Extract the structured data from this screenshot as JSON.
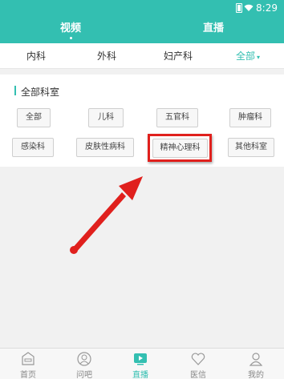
{
  "status_bar": {
    "time": "8:29"
  },
  "top_tabs": [
    {
      "label": "视频"
    },
    {
      "label": "直播"
    }
  ],
  "categories": [
    {
      "label": "内科"
    },
    {
      "label": "外科"
    },
    {
      "label": "妇产科"
    },
    {
      "label": "全部"
    }
  ],
  "panel": {
    "title": "全部科室",
    "departments": [
      {
        "label": "全部"
      },
      {
        "label": "儿科"
      },
      {
        "label": "五官科"
      },
      {
        "label": "肿瘤科"
      },
      {
        "label": "感染科"
      },
      {
        "label": "皮肤性病科"
      },
      {
        "label": "精神心理科"
      },
      {
        "label": "其他科室"
      }
    ]
  },
  "bottom_nav": [
    {
      "label": "首页",
      "icon": "home-icon"
    },
    {
      "label": "问吧",
      "icon": "doctor-icon"
    },
    {
      "label": "直播",
      "icon": "play-icon"
    },
    {
      "label": "医信",
      "icon": "heart-icon"
    },
    {
      "label": "我的",
      "icon": "user-icon"
    }
  ],
  "colors": {
    "accent": "#33bfb1",
    "annotation": "#e0201d"
  }
}
